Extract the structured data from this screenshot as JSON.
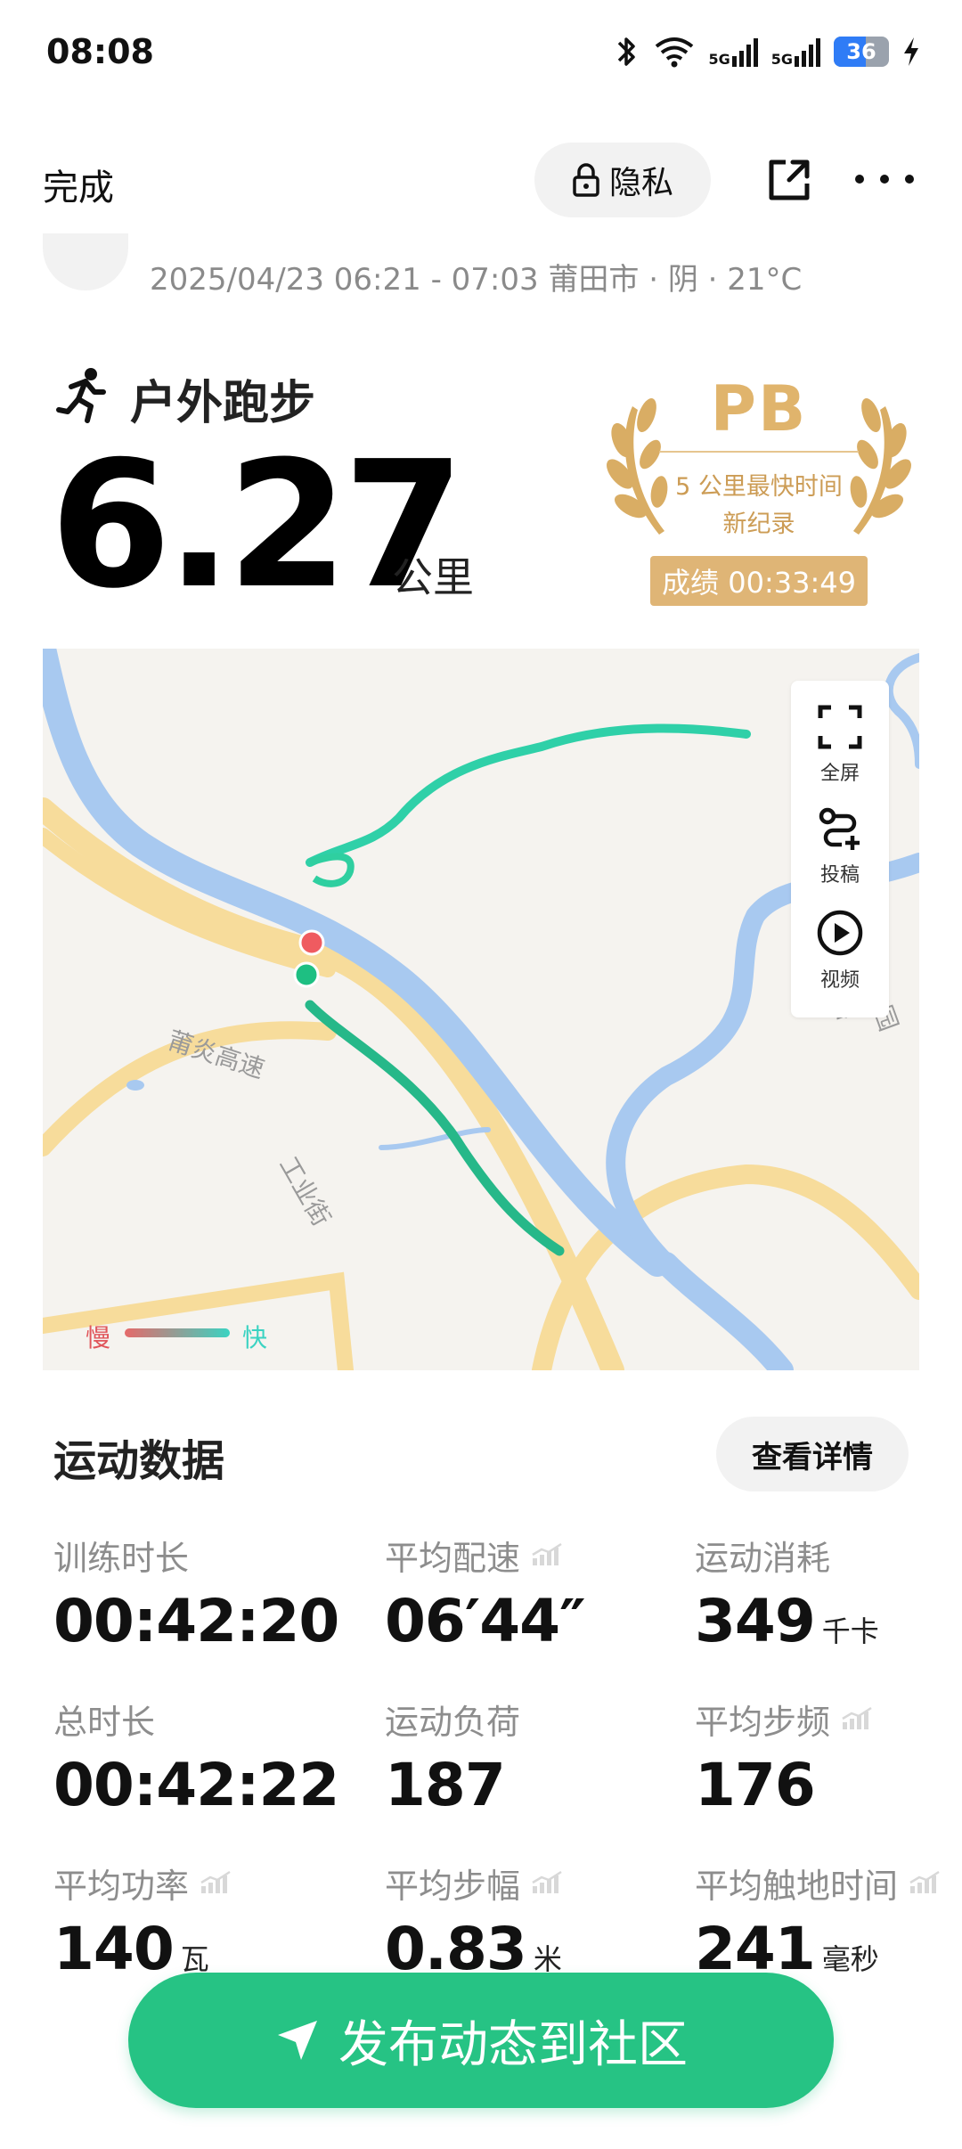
{
  "status_bar": {
    "time": "08:08",
    "battery": "36",
    "net1": "5G",
    "net2": "5G"
  },
  "topbar": {
    "done": "完成",
    "privacy": "隐私"
  },
  "meta": {
    "line": "2025/04/23 06:21 - 07:03 莆田市 · 阴 · 21°C"
  },
  "activity": {
    "type": "户外跑步",
    "distance": "6.27",
    "unit": "公里"
  },
  "pb": {
    "title": "PB",
    "line1": "5 公里最快时间",
    "line2": "新纪录",
    "score": "成绩 00:33:49"
  },
  "map": {
    "tools": [
      {
        "label": "全屏",
        "icon": "fullscreen-icon"
      },
      {
        "label": "投稿",
        "icon": "route-add-icon"
      },
      {
        "label": "视频",
        "icon": "play-icon"
      }
    ],
    "labels": {
      "road1": "莆炎高速",
      "road2": "工业街",
      "road3": "东园路"
    },
    "legend": {
      "slow": "慢",
      "fast": "快"
    }
  },
  "section": {
    "title": "运动数据",
    "detail_button": "查看详情"
  },
  "stats": [
    {
      "label": "训练时长",
      "value": "00:42:20",
      "unit": "",
      "trend": false
    },
    {
      "label": "平均配速",
      "value": "06′44″",
      "unit": "",
      "trend": true
    },
    {
      "label": "运动消耗",
      "value": "349",
      "unit": "千卡",
      "trend": false
    },
    {
      "label": "总时长",
      "value": "00:42:22",
      "unit": "",
      "trend": false
    },
    {
      "label": "运动负荷",
      "value": "187",
      "unit": "",
      "trend": false
    },
    {
      "label": "平均步频",
      "value": "176",
      "unit": "",
      "trend": true
    },
    {
      "label": "平均功率",
      "value": "140",
      "unit": "瓦",
      "trend": true
    },
    {
      "label": "平均步幅",
      "value": "0.83",
      "unit": "米",
      "trend": true
    },
    {
      "label": "平均触地时间",
      "value": "241",
      "unit": "毫秒",
      "trend": true
    }
  ],
  "publish": {
    "label": "发布动态到社区"
  },
  "colors": {
    "accent": "#26c384",
    "gold": "#dfb576",
    "route": "#2ec7a0",
    "river": "#a8c9f0",
    "road": "#f7dc9b"
  }
}
